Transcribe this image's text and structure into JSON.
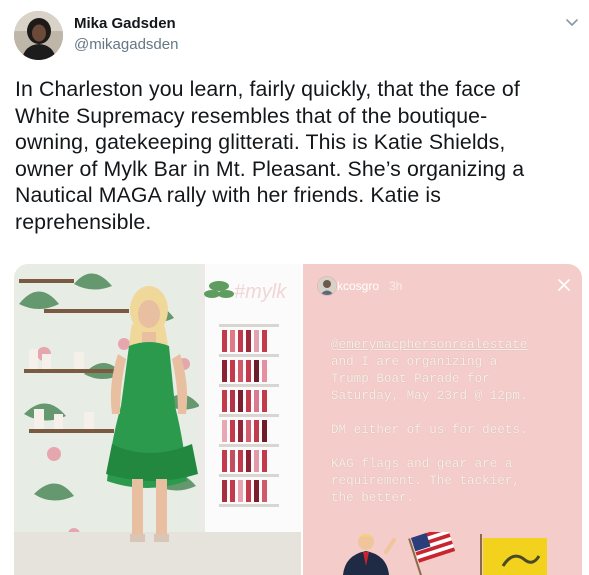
{
  "author": {
    "display_name": "Mika Gadsden",
    "handle": "@mikagadsden"
  },
  "tweet": {
    "lines": [
      "In Charleston you learn, fairly quickly, that the face of",
      "White Supremacy resembles that of the boutique-",
      "owning, gatekeeping glitterati. This is Katie Shields,",
      "owner of Mylk Bar in Mt. Pleasant. She’s organizing a",
      "Nautical MAGA rally with her friends. Katie is",
      "reprehensible."
    ]
  },
  "media": {
    "photo": {
      "sign_text": "#mylk"
    },
    "story": {
      "username": "kcosgro",
      "time": "3h",
      "mention": "@emerymacphersonrealestate",
      "lines_1": [
        "and I are organizing a",
        "Trump Boat Parade for",
        "Saturday, May 23rd @ 12pm."
      ],
      "line_2": "DM either of us for deets.",
      "lines_3": [
        "KAG flags and gear are a",
        "requirement. The tackier,",
        "the better."
      ]
    }
  },
  "icons": {
    "caret": "chevron-down-icon",
    "close": "close-icon",
    "flag": "american-flag-sticker",
    "gadsden": "gadsden-flag-sticker"
  },
  "colors": {
    "text": "#14171a",
    "secondary": "#657786",
    "story_bg": "#f4cdca"
  }
}
